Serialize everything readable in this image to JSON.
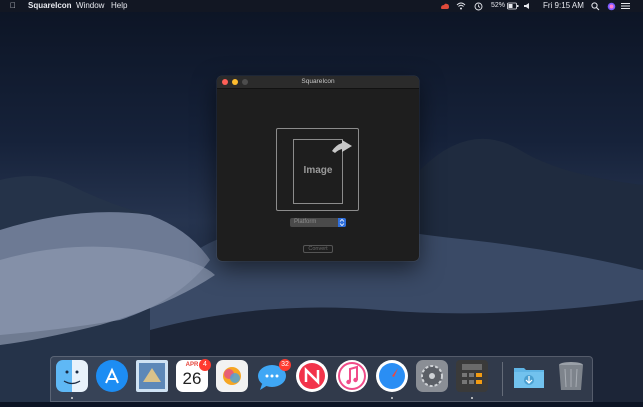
{
  "menubar": {
    "app_name": "SquareIcon",
    "menus": [
      "Window",
      "Help"
    ],
    "battery_percent": "52%",
    "clock": "Fri 9:15 AM"
  },
  "window": {
    "title": "SquareIcon",
    "drop_label": "Image",
    "platform_placeholder": "Platform",
    "convert_label": "Convert"
  },
  "dock": {
    "calendar_month": "APR",
    "calendar_day": "26",
    "calendar_badge": "4",
    "messages_badge": "32",
    "apps": [
      "Finder",
      "App Store",
      "Mail",
      "Calendar",
      "Photos",
      "Messages",
      "News",
      "iTunes",
      "Safari",
      "System Preferences",
      "Calculator",
      "Downloads",
      "Trash"
    ]
  }
}
